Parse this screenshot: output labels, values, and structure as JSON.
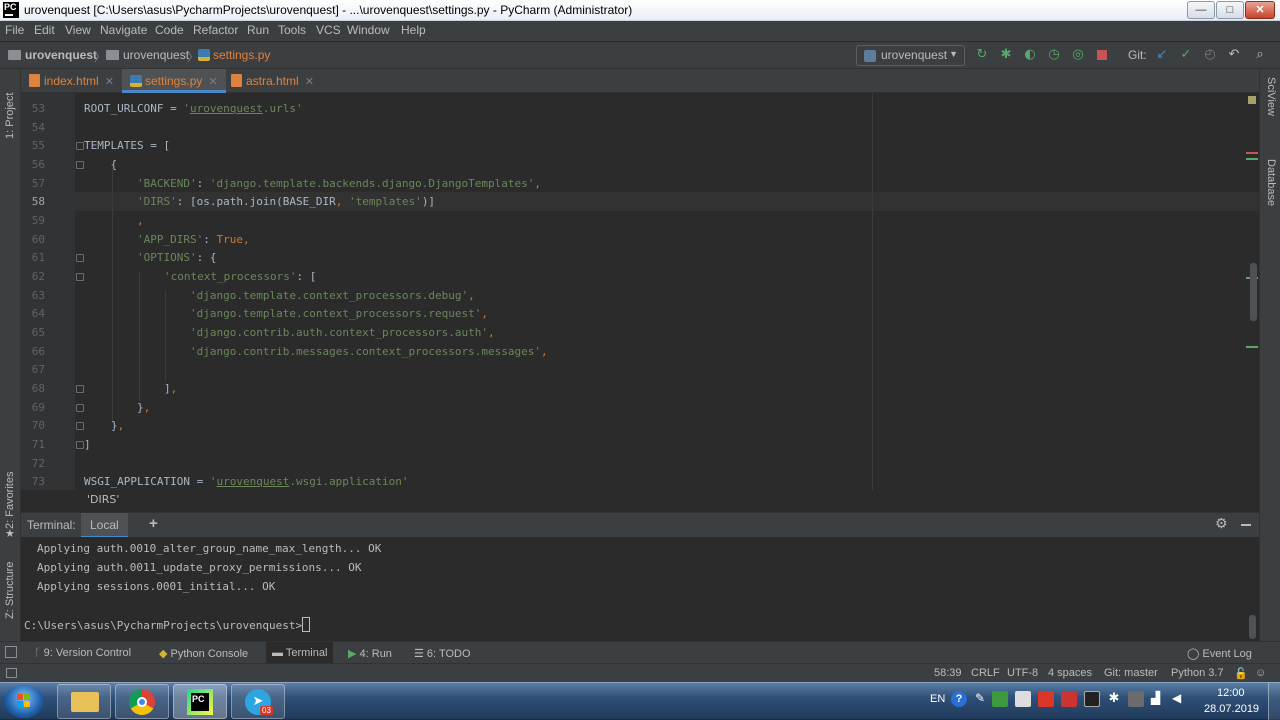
{
  "window": {
    "title": "urovenquest [C:\\Users\\asus\\PycharmProjects\\urovenquest] - ...\\urovenquest\\settings.py - PyCharm (Administrator)",
    "app_icon": "PC",
    "minimize": "—",
    "maximize": "□",
    "close": "✕"
  },
  "menu": [
    "File",
    "Edit",
    "View",
    "Navigate",
    "Code",
    "Refactor",
    "Run",
    "Tools",
    "VCS",
    "Window",
    "Help"
  ],
  "breadcrumb": {
    "root": "urovenquest",
    "folder": "urovenquest",
    "file": "settings.py"
  },
  "run_config": {
    "label": "urovenquest"
  },
  "git_label": "Git:",
  "tabs": [
    {
      "label": "index.html",
      "icon": "html-file-icon"
    },
    {
      "label": "settings.py",
      "icon": "python-file-icon",
      "active": true
    },
    {
      "label": "astra.html",
      "icon": "html-file-icon"
    }
  ],
  "left_panel": {
    "project": "1: Project",
    "favorites": "2: Favorites",
    "structure": "Z: Structure"
  },
  "right_panel": {
    "sciview": "SciView",
    "database": "Database"
  },
  "editor": {
    "current_line": "58",
    "lines": [
      {
        "n": "53"
      },
      {
        "n": "54"
      },
      {
        "n": "55"
      },
      {
        "n": "56"
      },
      {
        "n": "57"
      },
      {
        "n": "58"
      },
      {
        "n": "59"
      },
      {
        "n": "60"
      },
      {
        "n": "61"
      },
      {
        "n": "62"
      },
      {
        "n": "63"
      },
      {
        "n": "64"
      },
      {
        "n": "65"
      },
      {
        "n": "66"
      },
      {
        "n": "67"
      },
      {
        "n": "68"
      },
      {
        "n": "69"
      },
      {
        "n": "70"
      },
      {
        "n": "71"
      },
      {
        "n": "72"
      },
      {
        "n": "73"
      }
    ],
    "code": {
      "l53a": "ROOT_URLCONF = ",
      "l53b": "'",
      "l53c": "urovenquest",
      "l53d": ".urls'",
      "l55": "TEMPLATES = [",
      "l56": "    {",
      "l57a": "'BACKEND'",
      "l57b": ": ",
      "l57c": "'django.template.backends.django.DjangoTemplates'",
      "l57d": ",",
      "l58a": "'DIRS'",
      "l58b": ": [os.path.join(BASE_DIR",
      "l58c": ", ",
      "l58d": "'templates'",
      "l58e": ")]",
      "l59": ",",
      "l60a": "'APP_DIRS'",
      "l60b": ": ",
      "l60c": "True",
      "l60d": ",",
      "l61a": "'OPTIONS'",
      "l61b": ": {",
      "l62a": "'context_processors'",
      "l62b": ": [",
      "l63a": "'django.template.context_processors.debug'",
      "l63b": ",",
      "l64a": "'django.template.context_processors.request'",
      "l64b": ",",
      "l65a": "'django.contrib.auth.context_processors.auth'",
      "l65b": ",",
      "l66a": "'django.contrib.messages.context_processors.messages'",
      "l66b": ",",
      "l68a": "]",
      "l68b": ",",
      "l69a": "}",
      "l69b": ",",
      "l70a": "}",
      "l70b": ",",
      "l71": "]",
      "l73a": "WSGI_APPLICATION = ",
      "l73b": "'",
      "l73c": "urovenquest",
      "l73d": ".wsgi.application'"
    }
  },
  "tooltip": "'DIRS'",
  "terminal": {
    "title": "Terminal:",
    "tab": "Local",
    "add": "+",
    "lines": [
      "Applying auth.0010_alter_group_name_max_length... OK",
      "Applying auth.0011_update_proxy_permissions... OK",
      "Applying sessions.0001_initial... OK"
    ],
    "prompt": "C:\\Users\\asus\\PycharmProjects\\urovenquest>"
  },
  "bottom_tools": [
    {
      "label": "9: Version Control"
    },
    {
      "label": "Python Console"
    },
    {
      "label": "Terminal",
      "active": true
    },
    {
      "label": "4: Run"
    },
    {
      "label": "6: TODO"
    }
  ],
  "event_log": "Event Log",
  "status": {
    "position": "58:39",
    "line_sep": "CRLF",
    "encoding": "UTF-8",
    "indent": "4 spaces",
    "git": "Git: master",
    "interpreter": "Python 3.7"
  },
  "taskbar": {
    "lang": "EN",
    "time": "12:00",
    "date": "28.07.2019",
    "telegram_badge": "03"
  },
  "colors": {
    "accent": "#4a88c7",
    "string": "#6a8759",
    "keyword": "#cc7832",
    "ide_bg": "#2b2b2b"
  }
}
